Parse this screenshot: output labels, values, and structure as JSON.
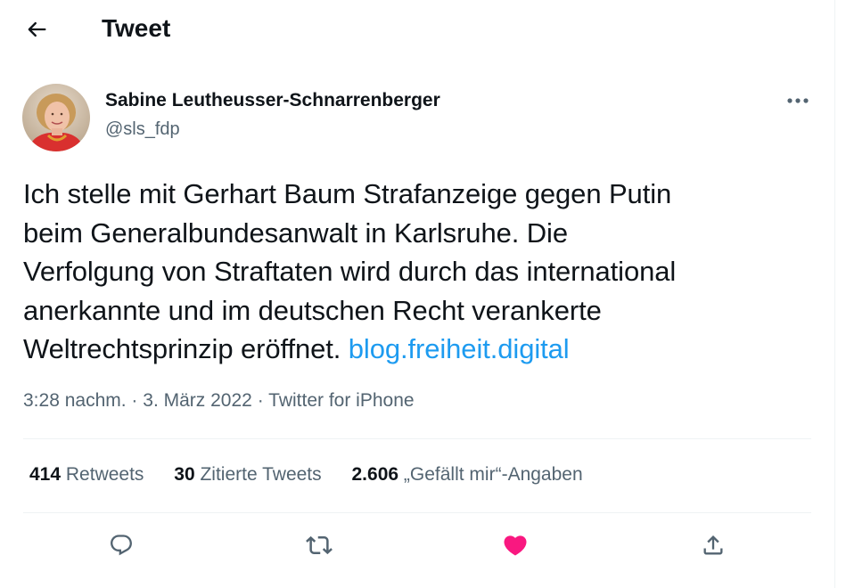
{
  "header": {
    "title": "Tweet",
    "back_icon": "arrow-left-icon"
  },
  "tweet": {
    "author": {
      "name": "Sabine Leutheusser-Schnarrenberger",
      "handle": "@sls_fdp",
      "avatar": "profile-photo"
    },
    "more_icon": "more-horizontal-icon",
    "text_lines": [
      "Ich stelle mit Gerhart Baum Strafanzeige gegen Putin",
      "beim Generalbundesanwalt in Karlsruhe. Die",
      "Verfolgung von Straftaten wird durch das international",
      "anerkannte und im deutschen Recht verankerte",
      "Weltrechtsprinzip eröffnet. "
    ],
    "link": "blog.freiheit.digital",
    "time": "3:28 nachm.",
    "separator": "·",
    "date": "3. März 2022",
    "source": "Twitter for iPhone"
  },
  "stats": {
    "retweets_count": "414",
    "retweets_label": "Retweets",
    "quotes_count": "30",
    "quotes_label": "Zitierte Tweets",
    "likes_count": "2.606",
    "likes_label": "„Gefällt mir“-Angaben"
  },
  "actions": {
    "reply_icon": "reply-icon",
    "retweet_icon": "retweet-icon",
    "like_icon": "heart-icon",
    "share_icon": "share-icon",
    "like_active": true
  },
  "colors": {
    "accent": "#1d9bf0",
    "like": "#f91880",
    "secondary_text": "#536471",
    "primary_text": "#0f1419",
    "divider": "#eff3f4"
  }
}
